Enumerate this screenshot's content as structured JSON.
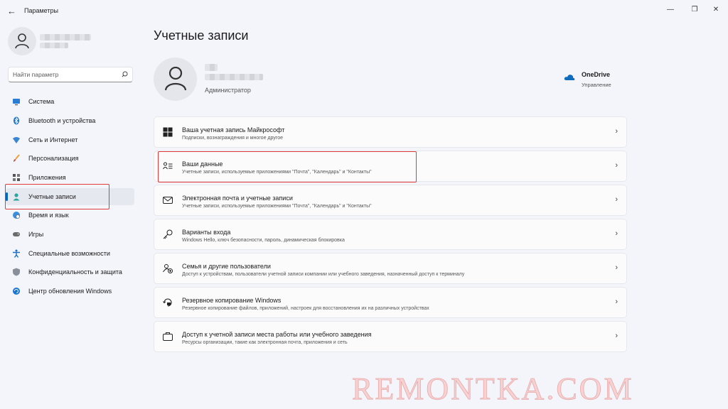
{
  "window": {
    "title": "Параметры",
    "back_icon": "←",
    "controls": [
      "—",
      "❐",
      "✕"
    ]
  },
  "sidebar": {
    "search_placeholder": "Найти параметр",
    "items": [
      {
        "label": "Система",
        "icon": "monitor-icon"
      },
      {
        "label": "Bluetooth и устройства",
        "icon": "bluetooth-icon"
      },
      {
        "label": "Сеть и Интернет",
        "icon": "network-icon"
      },
      {
        "label": "Персонализация",
        "icon": "brush-icon"
      },
      {
        "label": "Приложения",
        "icon": "apps-icon"
      },
      {
        "label": "Учетные записи",
        "icon": "person-icon",
        "selected": true
      },
      {
        "label": "Время и язык",
        "icon": "globe-clock-icon"
      },
      {
        "label": "Игры",
        "icon": "gamepad-icon"
      },
      {
        "label": "Специальные возможности",
        "icon": "accessibility-icon"
      },
      {
        "label": "Конфиденциальность и защита",
        "icon": "shield-icon"
      },
      {
        "label": "Центр обновления Windows",
        "icon": "update-icon"
      }
    ]
  },
  "main": {
    "title": "Учетные записи",
    "account_role": "Администратор",
    "onedrive": {
      "title": "OneDrive",
      "subtitle": "Управление"
    },
    "cards": [
      {
        "title": "Ваша учетная запись Майкрософт",
        "subtitle": "Подписки, вознаграждения и многое другое",
        "icon": "windows-logo-icon"
      },
      {
        "title": "Ваши данные",
        "subtitle": "Учетные записи, используемые приложениями \"Почта\", \"Календарь\" и \"Контакты\"",
        "icon": "person-list-icon"
      },
      {
        "title": "Электронная почта и учетные записи",
        "subtitle": "Учетные записи, используемые приложениями \"Почта\", \"Календарь\" и \"Контакты\"",
        "icon": "mail-icon"
      },
      {
        "title": "Варианты входа",
        "subtitle": "Windows Hello, ключ безопасности, пароль, динамическая блокировка",
        "icon": "key-icon"
      },
      {
        "title": "Семья и другие пользователи",
        "subtitle": "Доступ к устройствам, пользователи учетной записи компании или учебного заведения, назначенный доступ к терминалу",
        "icon": "family-icon"
      },
      {
        "title": "Резервное копирование Windows",
        "subtitle": "Резервное копирование файлов, приложений, настроек для восстановления их на различных устройствах",
        "icon": "backup-icon"
      },
      {
        "title": "Доступ к учетной записи места работы или учебного заведения",
        "subtitle": "Ресурсы организации, такие как электронная почта, приложения и сеть",
        "icon": "briefcase-icon"
      }
    ],
    "chevron": "›"
  },
  "watermark": "REMONTKA.COM",
  "colors": {
    "accent": "#0067c0",
    "highlight": "#e23b3b",
    "background": "#f3f5fa"
  }
}
